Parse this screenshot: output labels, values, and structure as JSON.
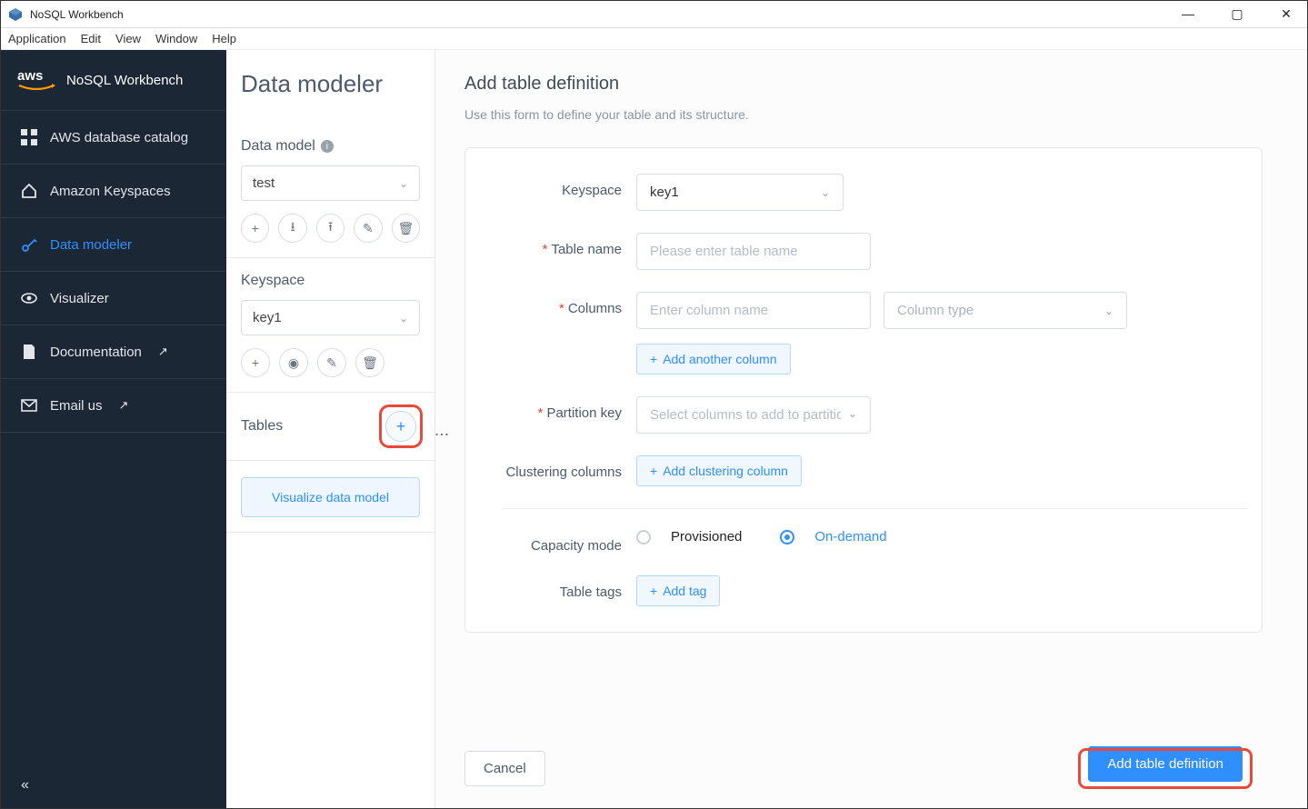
{
  "window": {
    "title": "NoSQL Workbench"
  },
  "menubar": [
    "Application",
    "Edit",
    "View",
    "Window",
    "Help"
  ],
  "brand": {
    "logo_text": "aws",
    "name": "NoSQL Workbench"
  },
  "nav": {
    "items": [
      {
        "label": "AWS database catalog"
      },
      {
        "label": "Amazon Keyspaces"
      },
      {
        "label": "Data modeler"
      },
      {
        "label": "Visualizer"
      },
      {
        "label": "Documentation"
      },
      {
        "label": "Email us"
      }
    ]
  },
  "mid": {
    "heading": "Data modeler",
    "data_model": {
      "title": "Data model",
      "value": "test"
    },
    "keyspace": {
      "title": "Keyspace",
      "value": "key1"
    },
    "tables": {
      "title": "Tables"
    },
    "visualize_button": "Visualize data model"
  },
  "form": {
    "title": "Add table definition",
    "subtitle": "Use this form to define your table and its structure.",
    "keyspace_label": "Keyspace",
    "keyspace_value": "key1",
    "table_name_label": "Table name",
    "table_name_placeholder": "Please enter table name",
    "columns_label": "Columns",
    "column_name_placeholder": "Enter column name",
    "column_type_placeholder": "Column type",
    "add_column": "Add another column",
    "partition_label": "Partition key",
    "partition_placeholder": "Select columns to add to partition",
    "clustering_label": "Clustering columns",
    "add_clustering": "Add clustering column",
    "capacity_label": "Capacity mode",
    "capacity_options": {
      "provisioned": "Provisioned",
      "ondemand": "On-demand"
    },
    "tags_label": "Table tags",
    "add_tag": "Add tag",
    "cancel": "Cancel",
    "submit": "Add table definition"
  }
}
